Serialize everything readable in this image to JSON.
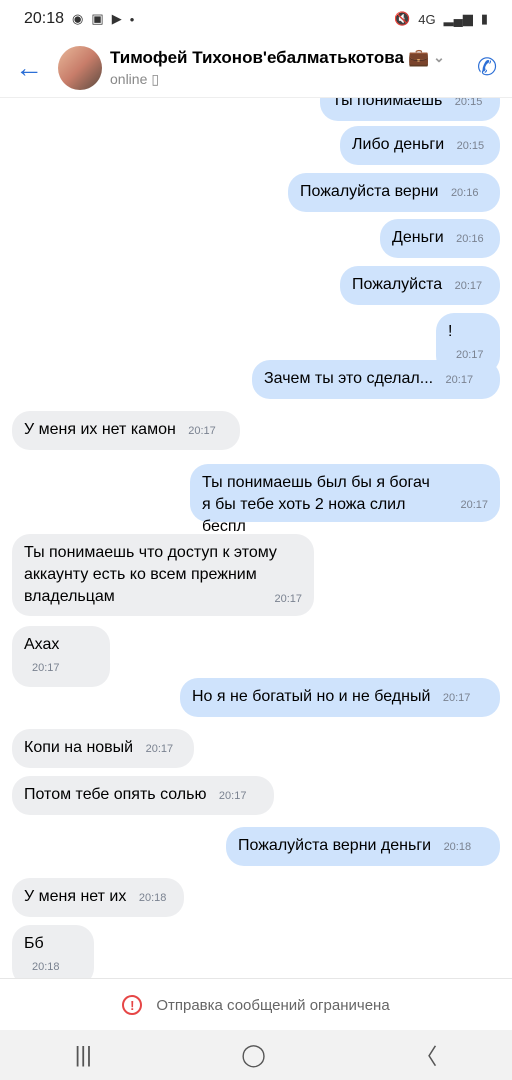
{
  "status_bar": {
    "time": "20:18",
    "network": "4G"
  },
  "header": {
    "name": "Тимофей Тихонов'ебалматькотова",
    "status": "online"
  },
  "messages": [
    {
      "text": "Ты понимаешь",
      "time": "20:15"
    },
    {
      "text": "Либо деньги",
      "time": "20:15"
    },
    {
      "text": "Пожалуйста верни",
      "time": "20:16"
    },
    {
      "text": "Деньги",
      "time": "20:16"
    },
    {
      "text": "Пожалуйста",
      "time": "20:17"
    },
    {
      "text": "!",
      "time": "20:17"
    },
    {
      "text": "Зачем  ты это сделал...",
      "time": "20:17"
    },
    {
      "text": "У меня их нет камон",
      "time": "20:17"
    },
    {
      "text": "Ты понимаешь был бы я богач я бы тебе хоть 2 ножа слил беспл",
      "time": "20:17"
    },
    {
      "text": "Ты понимаешь что доступ к этому аккаунту есть ко всем прежним владельцам",
      "time": "20:17"
    },
    {
      "text": "Ахах",
      "time": "20:17"
    },
    {
      "text": "Но я не богатый но и не бедный",
      "time": "20:17"
    },
    {
      "text": "Копи на новый",
      "time": "20:17"
    },
    {
      "text": "Потом тебе опять солью",
      "time": "20:17"
    },
    {
      "text": "Пожалуйста верни деньги",
      "time": "20:18"
    },
    {
      "text": "У меня нет их",
      "time": "20:18"
    },
    {
      "text": "Бб",
      "time": "20:18"
    }
  ],
  "footer": {
    "restricted": "Отправка сообщений ограничена"
  },
  "icons": {
    "back": "arrow-left-icon",
    "phone": "phone-icon",
    "warning": "warning-icon",
    "nav": [
      "recent-apps-icon",
      "home-icon",
      "back-nav-icon"
    ]
  },
  "colors": {
    "accent": "#2c6fd6",
    "outgoing": "#cfe3fc",
    "incoming": "#edeef0",
    "warning": "#e64646"
  }
}
